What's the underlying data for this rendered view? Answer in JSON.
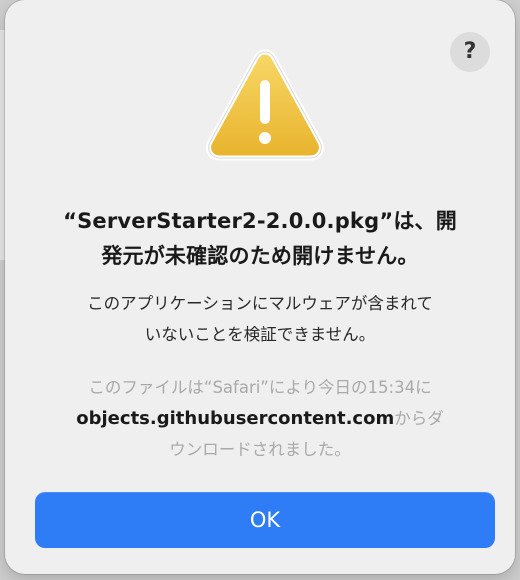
{
  "dialog": {
    "help_label": "?",
    "icon": "warning-triangle-icon",
    "title_line1": "“ServerStarter2-2.0.0.pkg”は、開",
    "title_line2": "発元が未確認のため開けません。",
    "message_line1": "このアプリケーションにマルウェアが含まれて",
    "message_line2": "いないことを検証できません。",
    "source_line1": "このファイルは“Safari”により今日の15:34に",
    "source_domain": "objects.githubusercontent.com",
    "source_line2_suffix": "からダ",
    "source_line3": "ウンロードされました。",
    "ok_label": "OK"
  },
  "colors": {
    "accent": "#2E7CF6",
    "warning": "#F0C640",
    "dialog_bg": "#EFEFEF"
  }
}
